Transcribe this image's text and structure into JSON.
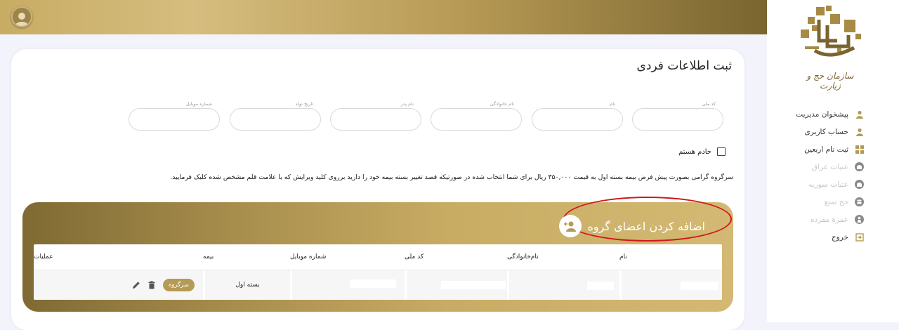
{
  "sidebar": {
    "logo_caption": "سازمان حج و زیارت",
    "items": [
      {
        "label": "پیشخوان مدیریت",
        "icon": "user-icon",
        "enabled": true
      },
      {
        "label": "حساب کاربری",
        "icon": "user-icon",
        "enabled": true
      },
      {
        "label": "ثبت نام اربعین",
        "icon": "grid-icon",
        "enabled": true
      },
      {
        "label": "عتبات عراق",
        "icon": "mosque-icon",
        "enabled": false
      },
      {
        "label": "عتبات سوریه",
        "icon": "mosque-icon",
        "enabled": false
      },
      {
        "label": "حج تمتع",
        "icon": "kaaba-icon",
        "enabled": false
      },
      {
        "label": "عمرهٔ مفرده",
        "icon": "pilgrim-icon",
        "enabled": false
      },
      {
        "label": "خروج",
        "icon": "logout-icon",
        "enabled": true
      }
    ],
    "colors": {
      "accent": "#b59a55",
      "disabled": "#c8c8c8"
    }
  },
  "form": {
    "title": "ثبت اطلاعات فردی",
    "fields": [
      {
        "label": "کد ملی",
        "value": ""
      },
      {
        "label": "نام",
        "value": ""
      },
      {
        "label": "نام خانوادگی",
        "value": ""
      },
      {
        "label": "نام پدر",
        "value": ""
      },
      {
        "label": "تاریخ تولد",
        "value": ""
      },
      {
        "label": "شماره موبایل",
        "value": ""
      }
    ],
    "checkbox_label": "خادم هستم",
    "checkbox_checked": false,
    "notice": "سرگروه گرامی بصورت پیش فرض بیمه بسته اول به قیمت ۳۵۰,۰۰۰ ریال برای شما انتخاب شده در صورتیکه قصد تغییر بسته بیمه خود را دارید برروی کلید ویرایش که با علامت قلم مشخص شده کلیک فرمایید."
  },
  "group": {
    "title": "اضافه کردن اعضای گروه",
    "columns": [
      "نام",
      "نام‌خانوادگی",
      "کد ملی",
      "شماره موبایل",
      "بیمه",
      "عملیات"
    ],
    "rows": [
      {
        "insurance": "بسته اول",
        "role": "سرگروه"
      }
    ]
  }
}
